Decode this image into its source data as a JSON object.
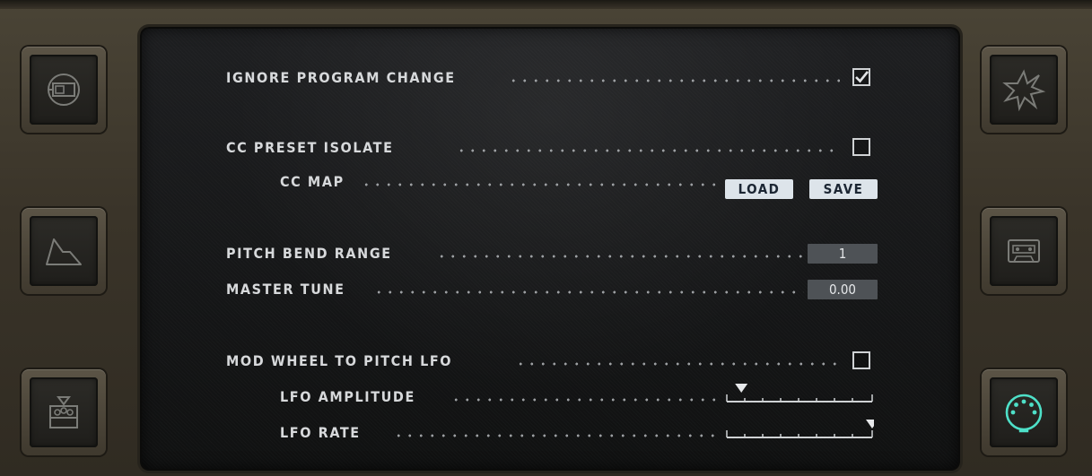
{
  "settings": {
    "ignore_program_change": {
      "label": "IGNORE PROGRAM CHANGE",
      "checked": true
    },
    "cc_preset_isolate": {
      "label": "CC PRESET ISOLATE",
      "checked": false
    },
    "cc_map": {
      "label": "CC MAP",
      "load_label": "LOAD",
      "save_label": "SAVE"
    },
    "pitch_bend_range": {
      "label": "PITCH BEND RANGE",
      "value": "1"
    },
    "master_tune": {
      "label": "MASTER TUNE",
      "value": "0.00"
    },
    "mod_wheel_to_pitch_lfo": {
      "label": "MOD WHEEL TO PITCH LFO",
      "checked": false
    },
    "lfo_amplitude": {
      "label": "LFO AMPLITUDE",
      "level": 0.1
    },
    "lfo_rate": {
      "label": "LFO RATE",
      "level": 1.0
    }
  },
  "sidebar_left": [
    "view-toggle-icon",
    "envelope-icon",
    "controller-icon"
  ],
  "sidebar_right": [
    "effects-starburst-icon",
    "cassette-icon",
    "midi-connector-icon"
  ],
  "colors": {
    "active_icon": "#4ee0c8",
    "inactive_icon": "#7b7c78",
    "text": "#d7d9db"
  }
}
